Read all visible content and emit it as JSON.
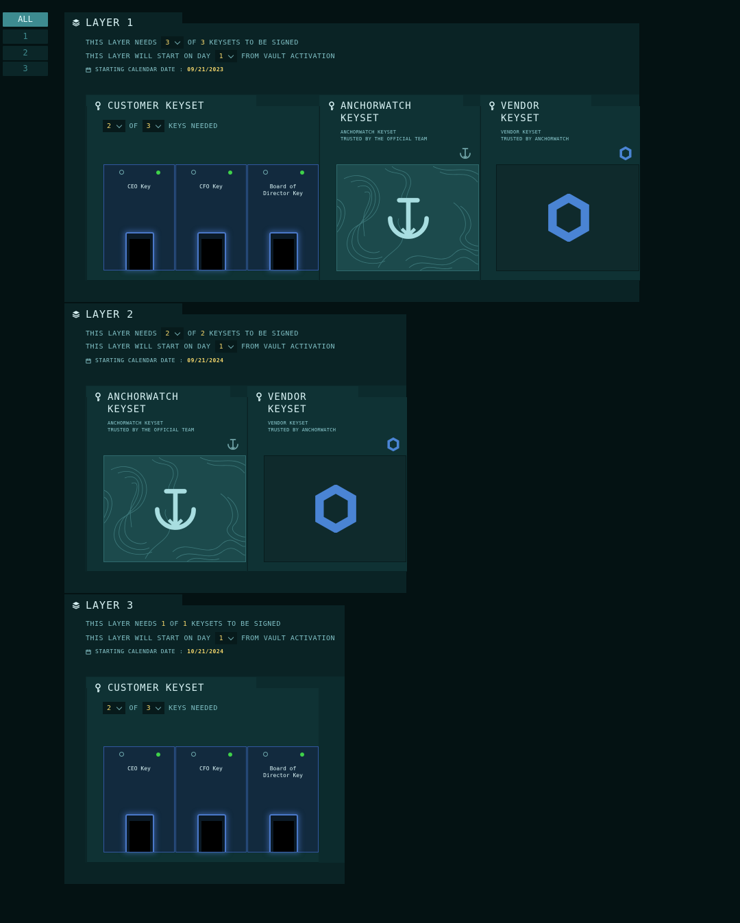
{
  "filters": [
    "ALL",
    "1",
    "2",
    "3"
  ],
  "layers": [
    {
      "title": "LAYER 1",
      "needs_prefix": "THIS LAYER NEEDS",
      "needs": "3",
      "of": "OF",
      "total": "3",
      "needs_suffix": "KEYSETS TO BE SIGNED",
      "start_prefix": "THIS LAYER WILL START ON DAY",
      "start_day": "1",
      "start_suffix": "FROM VAULT ACTIVATION",
      "calendar_label": "STARTING CALENDAR DATE",
      "colon": ":",
      "calendar_date": "09/21/2023"
    },
    {
      "title": "LAYER 2",
      "needs_prefix": "THIS LAYER NEEDS",
      "needs": "2",
      "of": "OF",
      "total": "2",
      "needs_suffix": "KEYSETS TO BE SIGNED",
      "start_prefix": "THIS LAYER WILL START ON DAY",
      "start_day": "1",
      "start_suffix": "FROM VAULT ACTIVATION",
      "calendar_label": "STARTING CALENDAR DATE",
      "colon": ":",
      "calendar_date": "09/21/2024"
    },
    {
      "title": "LAYER 3",
      "needs_prefix": "THIS LAYER NEEDS",
      "needs": "1",
      "of": "OF",
      "total": "1",
      "needs_suffix": "KEYSETS TO BE SIGNED",
      "start_prefix": "THIS LAYER WILL START ON DAY",
      "start_day": "1",
      "start_suffix": "FROM VAULT ACTIVATION",
      "calendar_label": "STARTING CALENDAR DATE",
      "colon": ":",
      "calendar_date": "10/21/2024"
    }
  ],
  "customer": {
    "title": "CUSTOMER KEYSET",
    "needed": "2",
    "of": "OF",
    "total": "3",
    "keys_needed": "KEYS NEEDED",
    "keys": [
      {
        "name_1": "CEO Key",
        "name_2": ""
      },
      {
        "name_1": "CFO Key",
        "name_2": ""
      },
      {
        "name_1": "Board of",
        "name_2": "Director Key"
      }
    ]
  },
  "anchorwatch": {
    "title_1": "ANCHORWATCH",
    "title_2": "KEYSET",
    "sub_1": "ANCHORWATCH KEYSET",
    "sub_2": "TRUSTED BY THE OFFICIAL TEAM"
  },
  "vendor": {
    "title_1": "VENDOR",
    "title_2": "KEYSET",
    "sub_1": "VENDOR KEYSET",
    "sub_2": "TRUSTED BY ANCHORWATCH"
  },
  "colors": {
    "accent": "#3d8b90",
    "highlight": "#f2d56b",
    "status_online": "#3fd14a",
    "vendor_blue": "#4a84d4"
  },
  "icons": [
    "layers-icon",
    "calendar-icon",
    "key-icon",
    "info-icon",
    "anchor-icon",
    "hexagon-icon",
    "chevron-down-icon"
  ]
}
